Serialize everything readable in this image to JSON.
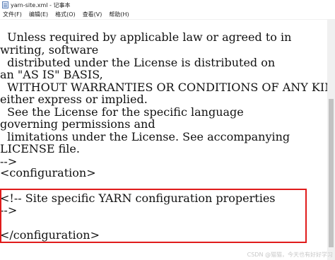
{
  "window": {
    "title": "yarn-site.xml - 记事本"
  },
  "menu": {
    "items": [
      "文件(F)",
      "编辑(E)",
      "格式(O)",
      "查看(V)",
      "帮助(H)"
    ]
  },
  "editor": {
    "lines": [
      "  Unless required by applicable law or agreed to in",
      "writing, software",
      "  distributed under the License is distributed on",
      "an \"AS IS\" BASIS,",
      "  WITHOUT WARRANTIES OR CONDITIONS OF ANY KIND,",
      "either express or implied.",
      "  See the License for the specific language",
      "governing permissions and",
      "  limitations under the License. See accompanying",
      "LICENSE file.",
      "-->",
      "<configuration>",
      "",
      "<!-- Site specific YARN configuration properties",
      "-->",
      "",
      "</configuration>"
    ]
  },
  "watermark": "CSDN @猫猫，今天也有好好学习"
}
